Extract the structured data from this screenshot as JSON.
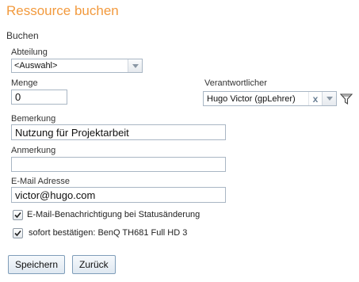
{
  "page": {
    "title": "Ressource buchen",
    "section": "Buchen"
  },
  "form": {
    "abteilung": {
      "label": "Abteilung",
      "value": "<Auswahl>"
    },
    "menge": {
      "label": "Menge",
      "value": "0"
    },
    "verantwortlicher": {
      "label": "Verantwortlicher",
      "value": "Hugo Victor (gpLehrer)",
      "clear_glyph": "x"
    },
    "bemerkung": {
      "label": "Bemerkung",
      "value": "Nutzung für Projektarbeit"
    },
    "anmerkung": {
      "label": "Anmerkung",
      "value": ""
    },
    "email": {
      "label": "E-Mail Adresse",
      "value": "victor@hugo.com"
    },
    "checkboxes": [
      {
        "label": "E-Mail-Benachrichtigung bei Statusänderung",
        "checked": true
      },
      {
        "label": "sofort bestätigen: BenQ TH681 Full HD 3",
        "checked": true
      }
    ]
  },
  "buttons": {
    "save": "Speichern",
    "back": "Zurück"
  },
  "colors": {
    "title": "#f29a3e",
    "field_border": "#a9b6c4",
    "button_border": "#7f9db9"
  },
  "icons": {
    "filter": "filter-icon",
    "dropdown": "chevron-down-icon",
    "check": "check-icon"
  }
}
